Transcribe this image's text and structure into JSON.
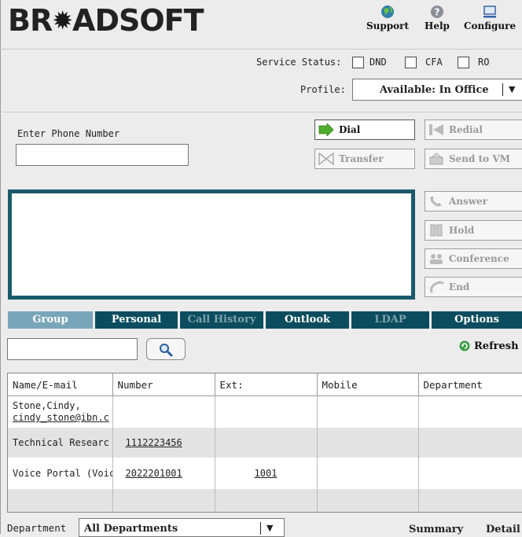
{
  "header": {
    "logo_left": "BR",
    "logo_right": "ADSOFT",
    "links": [
      {
        "label": "Support",
        "icon": "globe-icon"
      },
      {
        "label": "Help",
        "icon": "help-icon"
      },
      {
        "label": "Configure",
        "icon": "monitor-icon"
      }
    ]
  },
  "service_status": {
    "label": "Service Status:",
    "options": [
      {
        "label": "DND",
        "checked": false
      },
      {
        "label": "CFA",
        "checked": false
      },
      {
        "label": "RO",
        "checked": false
      }
    ]
  },
  "profile": {
    "label": "Profile:",
    "value": "Available: In Office"
  },
  "dialer": {
    "label": "Enter Phone Number",
    "value": "",
    "buttons": {
      "dial": "Dial",
      "redial": "Redial",
      "transfer": "Transfer",
      "send_to_vm": "Send to VM"
    }
  },
  "call_controls": {
    "answer": "Answer",
    "hold": "Hold",
    "conference": "Conference",
    "end": "End"
  },
  "tabs": [
    {
      "label": "Group",
      "state": "active"
    },
    {
      "label": "Personal",
      "state": "normal"
    },
    {
      "label": "Call History",
      "state": "disabled"
    },
    {
      "label": "Outlook",
      "state": "normal"
    },
    {
      "label": "LDAP",
      "state": "disabled"
    },
    {
      "label": "Options",
      "state": "normal"
    }
  ],
  "search": {
    "value": "",
    "refresh_label": "Refresh"
  },
  "directory": {
    "columns": [
      "Name/E-mail",
      "Number",
      "Ext:",
      "Mobile",
      "Department"
    ],
    "rows": [
      {
        "name": "Stone,Cindy,",
        "email": "cindy_stone@ibn.c",
        "number": "",
        "ext": "",
        "mobile": "",
        "department": ""
      },
      {
        "name": "Technical Researc",
        "email": "",
        "number": "1112223456",
        "ext": "",
        "mobile": "",
        "department": ""
      },
      {
        "name": "Voice Portal (Voic",
        "email": "",
        "number": "2022201001",
        "ext": "1001",
        "mobile": "",
        "department": ""
      }
    ]
  },
  "footer": {
    "department_label": "Department",
    "department_value": "All Departments",
    "summary": "Summary",
    "detail": "Detail"
  },
  "colors": {
    "tab_bg": "#0b4d5e",
    "tab_active_bg": "#78a6b8",
    "call_area_border": "#1b5a6a"
  }
}
